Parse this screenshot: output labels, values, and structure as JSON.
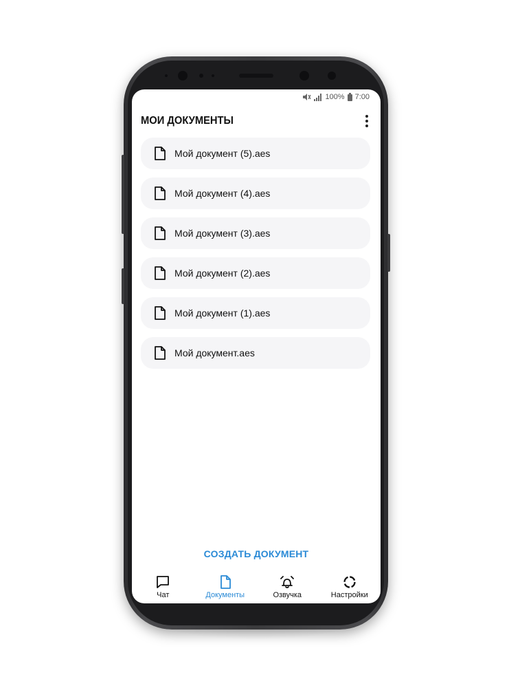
{
  "status_bar": {
    "battery": "100%",
    "time": "7:00",
    "icons": [
      "mute-icon",
      "signal-icon",
      "battery-icon"
    ]
  },
  "header": {
    "title": "МОИ ДОКУМЕНТЫ",
    "menu_icon": "more-vertical-icon"
  },
  "documents": [
    {
      "name": "Мой документ (5).aes",
      "icon": "file-icon"
    },
    {
      "name": "Мой документ (4).aes",
      "icon": "file-icon"
    },
    {
      "name": "Мой документ (3).aes",
      "icon": "file-icon"
    },
    {
      "name": "Мой документ (2).aes",
      "icon": "file-icon"
    },
    {
      "name": "Мой документ (1).aes",
      "icon": "file-icon"
    },
    {
      "name": "Мой документ.aes",
      "icon": "file-icon"
    }
  ],
  "create_button": "СОЗДАТЬ ДОКУМЕНТ",
  "bottom_nav": [
    {
      "label": "Чат",
      "icon": "chat-icon",
      "active": false
    },
    {
      "label": "Документы",
      "icon": "file-icon",
      "active": true
    },
    {
      "label": "Озвучка",
      "icon": "alarm-bell-icon",
      "active": false
    },
    {
      "label": "Настройки",
      "icon": "settings-ring-icon",
      "active": false
    }
  ],
  "colors": {
    "accent": "#2a8ad6",
    "item_background": "#f5f5f7",
    "text": "#111111"
  }
}
